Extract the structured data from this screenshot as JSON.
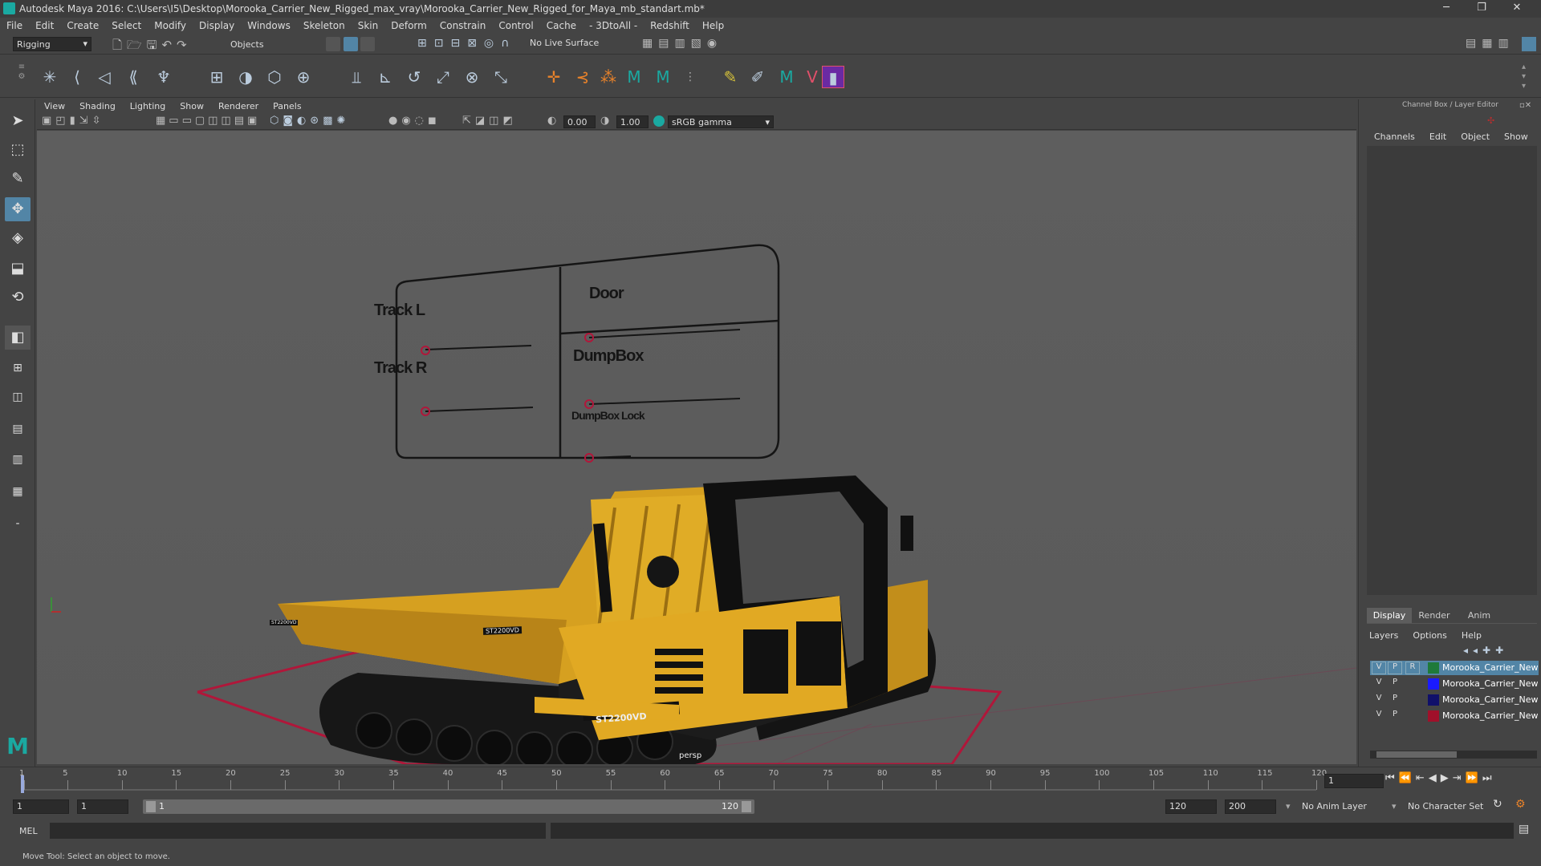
{
  "title": "Autodesk Maya 2016: C:\\Users\\I5\\Desktop\\Morooka_Carrier_New_Rigged_max_vray\\Morooka_Carrier_New_Rigged_for_Maya_mb_standart.mb*",
  "window_controls": {
    "minimize": "─",
    "restore": "❐",
    "close": "✕"
  },
  "menubar": [
    "File",
    "Edit",
    "Create",
    "Select",
    "Modify",
    "Display",
    "Windows",
    "Skeleton",
    "Skin",
    "Deform",
    "Constrain",
    "Control",
    "Cache",
    "- 3DtoAll -",
    "Redshift",
    "Help"
  ],
  "status": {
    "menu_set": "Rigging",
    "selection_mode": "Objects",
    "live_surface": "No Live Surface"
  },
  "panel_menu": [
    "View",
    "Shading",
    "Lighting",
    "Show",
    "Renderer",
    "Panels"
  ],
  "panel_tools": {
    "exposure": "0.00",
    "gamma": "1.00",
    "color_space": "sRGB gamma"
  },
  "controls": {
    "track_l": "Track L",
    "track_r": "Track R",
    "door": "Door",
    "dumpbox": "DumpBox",
    "dumpbox_lock": "DumpBox Lock"
  },
  "viewport": {
    "camera_label": "persp",
    "model_badge_1": "ST2200VD",
    "model_badge_2": "ST2200VD",
    "model_badge_3": "ST2200VD"
  },
  "right_panel": {
    "header": "Channel Box / Layer Editor",
    "menu": [
      "Channels",
      "Edit",
      "Object",
      "Show"
    ],
    "tabs": [
      "Display",
      "Render",
      "Anim"
    ],
    "layer_menu": [
      "Layers",
      "Options",
      "Help"
    ],
    "layers": [
      {
        "v": "V",
        "p": "P",
        "r": "R",
        "color": "#1f7a3a",
        "name": "Morooka_Carrier_New"
      },
      {
        "v": "V",
        "p": "P",
        "r": "",
        "color": "#1a1aff",
        "name": "Morooka_Carrier_New"
      },
      {
        "v": "V",
        "p": "P",
        "r": "",
        "color": "#10106a",
        "name": "Morooka_Carrier_New"
      },
      {
        "v": "V",
        "p": "P",
        "r": "",
        "color": "#a0102a",
        "name": "Morooka_Carrier_New"
      }
    ]
  },
  "timeline": {
    "ticks": [
      "1",
      "5",
      "10",
      "15",
      "20",
      "25",
      "30",
      "35",
      "40",
      "45",
      "50",
      "55",
      "60",
      "65",
      "70",
      "75",
      "80",
      "85",
      "90",
      "95",
      "100",
      "105",
      "110",
      "115",
      "120"
    ],
    "current_frame": "1"
  },
  "range": {
    "start": "1",
    "start_inner": "1",
    "slider_start": "1",
    "slider_end": "120",
    "end_inner": "120",
    "end": "200",
    "anim_layer": "No Anim Layer",
    "char_set": "No Character Set"
  },
  "cmdline": {
    "label": "MEL"
  },
  "help_line": "Move Tool: Select an object to move."
}
